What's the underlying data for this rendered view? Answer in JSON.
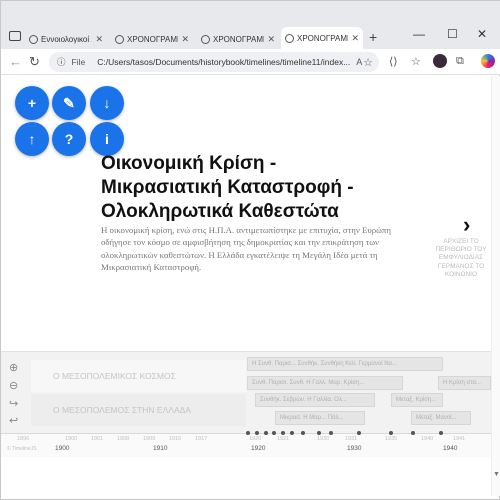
{
  "tabs": [
    {
      "label": "Εννοιολογικοί Χ",
      "active": false
    },
    {
      "label": "ΧΡΟΝΟΓΡΑΜΜ",
      "active": false
    },
    {
      "label": "ΧΡΟΝΟΓΡΑΜΜ",
      "active": false
    },
    {
      "label": "ΧΡΟΝΟΓΡΑΜΜ",
      "active": true
    }
  ],
  "new_tab_label": "+",
  "window_controls": {
    "minimize": "—",
    "maximize": "☐",
    "close": "✕"
  },
  "address": {
    "scheme_label": "File",
    "url": "C:/Users/tasos/Documents/historybook/timelines/timeline11/index...",
    "zoom": "A",
    "star": "☆"
  },
  "toolbar_icons": {
    "tab_icon": "⟨⟩",
    "favorites": "☆",
    "collections": "⧉"
  },
  "fab_buttons": [
    {
      "name": "zoom-in-button",
      "glyph": "+"
    },
    {
      "name": "pen-button",
      "glyph": "✎"
    },
    {
      "name": "download-button",
      "glyph": "↓"
    },
    {
      "name": "upload-button",
      "glyph": "↑"
    },
    {
      "name": "help-button",
      "glyph": "?"
    },
    {
      "name": "info-button",
      "glyph": "i"
    }
  ],
  "slide": {
    "title": "Οικονομική Κρίση - Μικρασιατική Καταστροφή - Ολοκληρωτικά Καθεστώτα",
    "description": "Η οικονομική κρίση, ενώ στις Η.Π.Α. αντιμετωπίστηκε με επιτυχία, στην Ευρώπη οδήγησε τον κόσμο σε αμφισβήτηση της δημοκρατίας και την επικράτηση των ολοκληρωτικών καθεστώτων. Η Ελλάδα εγκατέλειψε τη Μεγάλη Ιδέα μετά τη Μικρασιατική Καταστροφή.",
    "next_arrow": "›",
    "next_label": "ΑΡΧΙΖΕΙ ΤΟ ΠΕΡΙΘΩΡΙΟ ΤΟΥ ΕΜΦΥΛΙΟΔΙΑΣ ΓΕΡΜΑΝΟΣ ΤΟ ΚΟΙΝΩΝΙΟ"
  },
  "timeline": {
    "controls": [
      "⊕",
      "⊖",
      "↪",
      "↩"
    ],
    "groups": [
      "Ο ΜΕΣΟΠΟΛΕΜΙΚΟΣ ΚΟΣΜΟΣ",
      "Ο ΜΕΣΟΠΟΛΕΜΟΣ ΣΤΗΝ ΕΛΛΑΔΑ"
    ],
    "events": [
      "Η Συνθ. Παρισ... Συνθήκ. Συνθήκη Κεϋ. Γερμανοί Να...",
      "Συνθ. Παρισι. Συνθ. Η Γαλλ. Μαρ. Κρίση...",
      "Η Κρίση στα...",
      "Συνθήκ. Σεβρών. Η Γαλλία. Ολ...",
      "Μεταξ. Κρίση...",
      "Μικρασ. Η Μαρ... Πάλ...",
      "Μεταξ. Μανοί..."
    ],
    "minor_labels": [
      "1896",
      "1900",
      "1901",
      "1908",
      "1909",
      "1916",
      "1917",
      "1920",
      "1921",
      "1930",
      "1931",
      "1935",
      "1940",
      "1941"
    ],
    "major_labels": [
      "1900",
      "1910",
      "1920",
      "1930",
      "1940"
    ],
    "watermark": "© TimelineJS"
  }
}
